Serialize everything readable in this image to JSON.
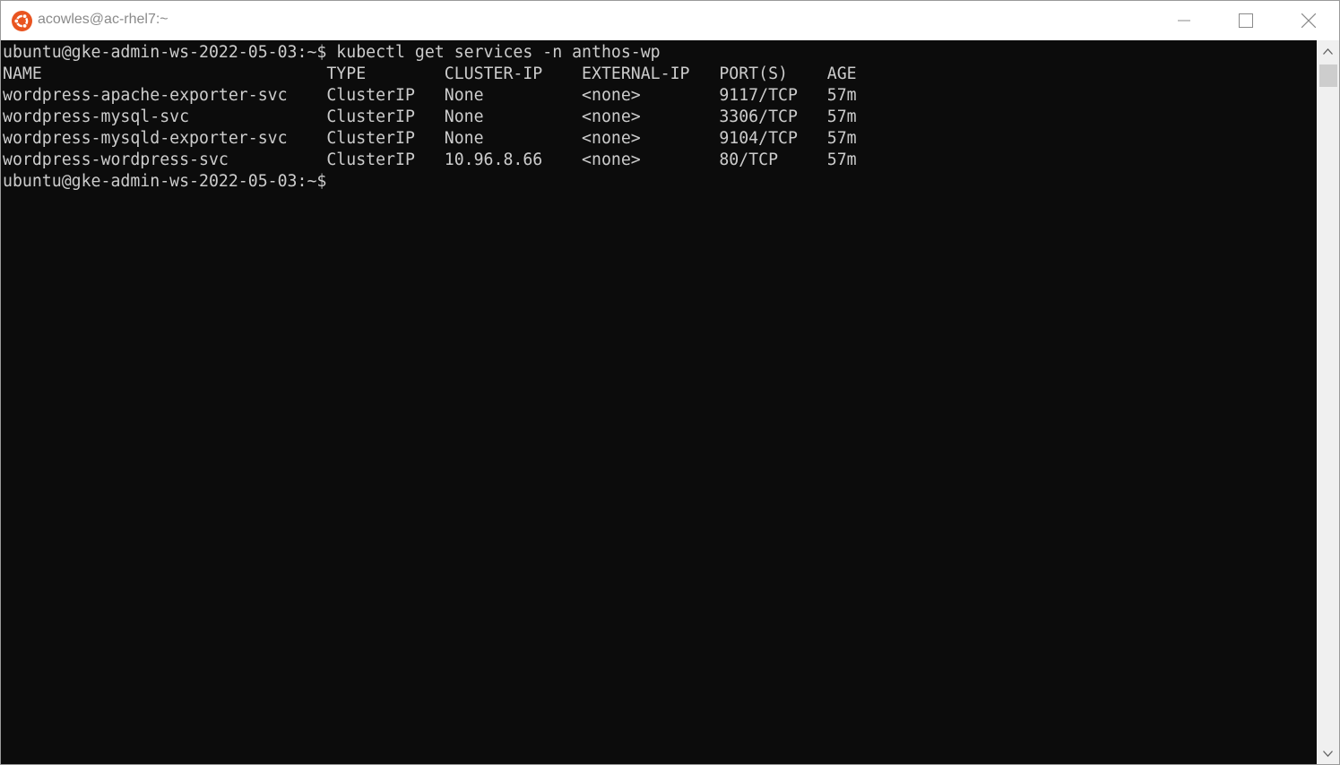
{
  "window": {
    "title": "acowles@ac-rhel7:~",
    "app_icon": "ubuntu-logo-icon",
    "controls": [
      "minimize-icon",
      "maximize-icon",
      "close-icon"
    ],
    "accent_color": "#e95420"
  },
  "terminal": {
    "background": "#0c0c0c",
    "foreground": "#cccccc",
    "lines": [
      "ubuntu@gke-admin-ws-2022-05-03:~$ kubectl get services -n anthos-wp",
      "NAME                             TYPE        CLUSTER-IP    EXTERNAL-IP   PORT(S)    AGE",
      "wordpress-apache-exporter-svc    ClusterIP   None          <none>        9117/TCP   57m",
      "wordpress-mysql-svc              ClusterIP   None          <none>        3306/TCP   57m",
      "wordpress-mysqld-exporter-svc    ClusterIP   None          <none>        9104/TCP   57m",
      "wordpress-wordpress-svc          ClusterIP   10.96.8.66    <none>        80/TCP     57m",
      "ubuntu@gke-admin-ws-2022-05-03:~$"
    ]
  },
  "scrollbar": {
    "up_icon": "scroll-up-arrow-icon",
    "down_icon": "scroll-down-arrow-icon"
  }
}
